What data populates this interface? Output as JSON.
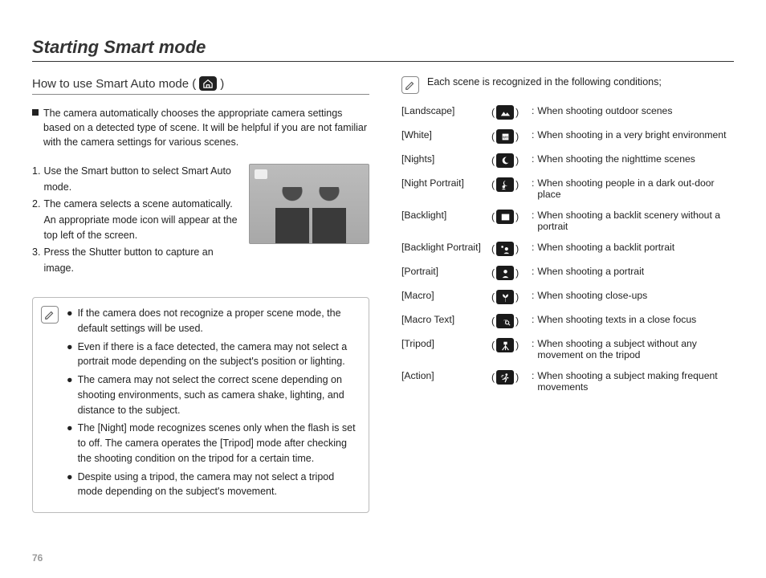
{
  "title": "Starting Smart mode",
  "page_number": "76",
  "left": {
    "subhead_a": "How to use Smart Auto mode (",
    "subhead_b": ")",
    "intro": "The camera automatically chooses the appropriate camera settings based on a detected type of scene. It will be helpful if you are not familiar with the camera settings for various scenes.",
    "steps": [
      {
        "n": "1.",
        "t": "Use the Smart button to select Smart Auto mode."
      },
      {
        "n": "2.",
        "t": "The camera selects a scene automatically. An appropriate mode icon will appear at the top left of the screen."
      },
      {
        "n": "3.",
        "t": "Press the Shutter button to capture an image."
      }
    ],
    "notes": [
      "If the camera does not recognize a proper scene mode, the default settings will be used.",
      "Even if there is a face detected, the camera may not select a portrait mode depending on the subject's position or lighting.",
      "The camera may not select the correct scene depending on shooting environments, such as camera shake, lighting, and distance to the subject.",
      "The [Night] mode recognizes scenes only when the flash is set to off. The camera operates the [Tripod] mode after checking the shooting condition on the tripod for a certain time.",
      "Despite using a tripod, the camera may not select a tripod mode depending on the subject's movement."
    ]
  },
  "right": {
    "heading": "Each scene is recognized in the following conditions;",
    "scenes": [
      {
        "name": "[Landscape]",
        "icon": "landscape-icon",
        "desc": "When shooting outdoor scenes"
      },
      {
        "name": "[White]",
        "icon": "white-icon",
        "desc": "When shooting in a very bright environment"
      },
      {
        "name": "[Nights]",
        "icon": "nights-icon",
        "desc": "When shooting the nighttime scenes"
      },
      {
        "name": "[Night Portrait]",
        "icon": "night-portrait-icon",
        "desc": "When shooting people in a dark out-door place"
      },
      {
        "name": "[Backlight]",
        "icon": "backlight-icon",
        "desc": "When shooting a backlit scenery without a portrait"
      },
      {
        "name": "[Backlight Portrait]",
        "icon": "backlight-portrait-icon",
        "desc": "When shooting a backlit portrait"
      },
      {
        "name": "[Portrait]",
        "icon": "portrait-icon",
        "desc": "When shooting a portrait"
      },
      {
        "name": "[Macro]",
        "icon": "macro-icon",
        "desc": "When shooting close-ups"
      },
      {
        "name": "[Macro Text]",
        "icon": "macro-text-icon",
        "desc": "When shooting texts in a close focus"
      },
      {
        "name": "[Tripod]",
        "icon": "tripod-icon",
        "desc": "When shooting a subject without any movement on the tripod"
      },
      {
        "name": "[Action]",
        "icon": "action-icon",
        "desc": "When shooting a subject making frequent movements"
      }
    ]
  }
}
